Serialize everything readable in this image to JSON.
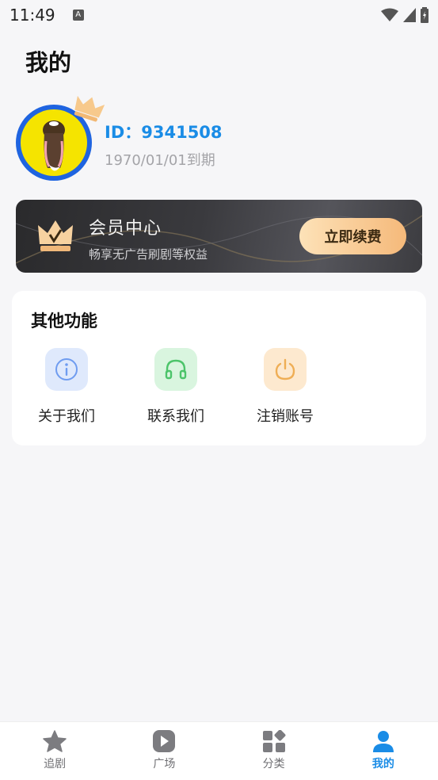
{
  "status_bar": {
    "time": "11:49",
    "notif_badge": "A"
  },
  "page": {
    "title": "我的"
  },
  "user": {
    "id_text": "ID：9341508",
    "expire_text": "1970/01/01到期"
  },
  "vip": {
    "title": "会员中心",
    "subtitle": "畅享无广告刷剧等权益",
    "button_label": "立即续费"
  },
  "features": {
    "title": "其他功能",
    "items": [
      {
        "label": "关于我们",
        "icon": "info-icon",
        "color": "#6f9cf0",
        "bg": "#dfe9fc"
      },
      {
        "label": "联系我们",
        "icon": "headset-icon",
        "color": "#4cc46a",
        "bg": "#d9f5df"
      },
      {
        "label": "注销账号",
        "icon": "power-icon",
        "color": "#efae55",
        "bg": "#fde9cf"
      }
    ]
  },
  "tabs": [
    {
      "label": "追剧",
      "icon": "star-icon"
    },
    {
      "label": "广场",
      "icon": "play-icon"
    },
    {
      "label": "分类",
      "icon": "category-icon"
    },
    {
      "label": "我的",
      "icon": "user-icon",
      "active": true
    }
  ],
  "colors": {
    "accent": "#1a8ce6",
    "tab_inactive": "#6f6f73",
    "vip_gold": "#f5b97a"
  }
}
